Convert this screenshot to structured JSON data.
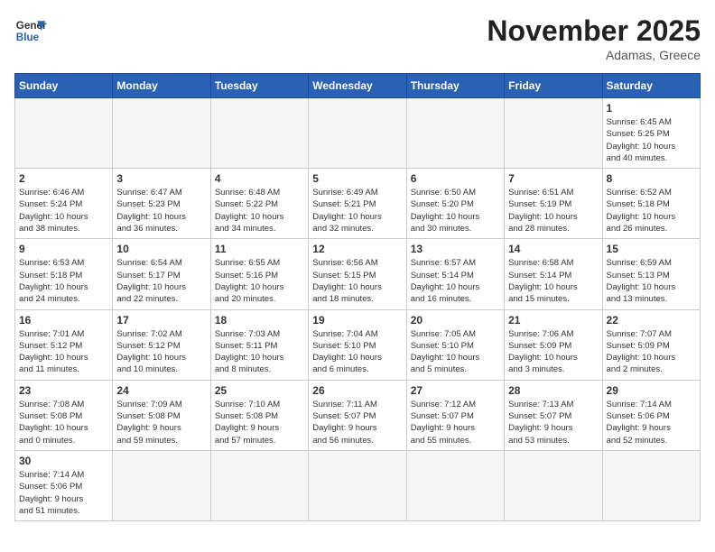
{
  "header": {
    "logo_text_general": "General",
    "logo_text_blue": "Blue",
    "month": "November 2025",
    "location": "Adamas, Greece"
  },
  "weekdays": [
    "Sunday",
    "Monday",
    "Tuesday",
    "Wednesday",
    "Thursday",
    "Friday",
    "Saturday"
  ],
  "weeks": [
    [
      {
        "day": "",
        "info": ""
      },
      {
        "day": "",
        "info": ""
      },
      {
        "day": "",
        "info": ""
      },
      {
        "day": "",
        "info": ""
      },
      {
        "day": "",
        "info": ""
      },
      {
        "day": "",
        "info": ""
      },
      {
        "day": "1",
        "info": "Sunrise: 6:45 AM\nSunset: 5:25 PM\nDaylight: 10 hours\nand 40 minutes."
      }
    ],
    [
      {
        "day": "2",
        "info": "Sunrise: 6:46 AM\nSunset: 5:24 PM\nDaylight: 10 hours\nand 38 minutes."
      },
      {
        "day": "3",
        "info": "Sunrise: 6:47 AM\nSunset: 5:23 PM\nDaylight: 10 hours\nand 36 minutes."
      },
      {
        "day": "4",
        "info": "Sunrise: 6:48 AM\nSunset: 5:22 PM\nDaylight: 10 hours\nand 34 minutes."
      },
      {
        "day": "5",
        "info": "Sunrise: 6:49 AM\nSunset: 5:21 PM\nDaylight: 10 hours\nand 32 minutes."
      },
      {
        "day": "6",
        "info": "Sunrise: 6:50 AM\nSunset: 5:20 PM\nDaylight: 10 hours\nand 30 minutes."
      },
      {
        "day": "7",
        "info": "Sunrise: 6:51 AM\nSunset: 5:19 PM\nDaylight: 10 hours\nand 28 minutes."
      },
      {
        "day": "8",
        "info": "Sunrise: 6:52 AM\nSunset: 5:18 PM\nDaylight: 10 hours\nand 26 minutes."
      }
    ],
    [
      {
        "day": "9",
        "info": "Sunrise: 6:53 AM\nSunset: 5:18 PM\nDaylight: 10 hours\nand 24 minutes."
      },
      {
        "day": "10",
        "info": "Sunrise: 6:54 AM\nSunset: 5:17 PM\nDaylight: 10 hours\nand 22 minutes."
      },
      {
        "day": "11",
        "info": "Sunrise: 6:55 AM\nSunset: 5:16 PM\nDaylight: 10 hours\nand 20 minutes."
      },
      {
        "day": "12",
        "info": "Sunrise: 6:56 AM\nSunset: 5:15 PM\nDaylight: 10 hours\nand 18 minutes."
      },
      {
        "day": "13",
        "info": "Sunrise: 6:57 AM\nSunset: 5:14 PM\nDaylight: 10 hours\nand 16 minutes."
      },
      {
        "day": "14",
        "info": "Sunrise: 6:58 AM\nSunset: 5:14 PM\nDaylight: 10 hours\nand 15 minutes."
      },
      {
        "day": "15",
        "info": "Sunrise: 6:59 AM\nSunset: 5:13 PM\nDaylight: 10 hours\nand 13 minutes."
      }
    ],
    [
      {
        "day": "16",
        "info": "Sunrise: 7:01 AM\nSunset: 5:12 PM\nDaylight: 10 hours\nand 11 minutes."
      },
      {
        "day": "17",
        "info": "Sunrise: 7:02 AM\nSunset: 5:12 PM\nDaylight: 10 hours\nand 10 minutes."
      },
      {
        "day": "18",
        "info": "Sunrise: 7:03 AM\nSunset: 5:11 PM\nDaylight: 10 hours\nand 8 minutes."
      },
      {
        "day": "19",
        "info": "Sunrise: 7:04 AM\nSunset: 5:10 PM\nDaylight: 10 hours\nand 6 minutes."
      },
      {
        "day": "20",
        "info": "Sunrise: 7:05 AM\nSunset: 5:10 PM\nDaylight: 10 hours\nand 5 minutes."
      },
      {
        "day": "21",
        "info": "Sunrise: 7:06 AM\nSunset: 5:09 PM\nDaylight: 10 hours\nand 3 minutes."
      },
      {
        "day": "22",
        "info": "Sunrise: 7:07 AM\nSunset: 5:09 PM\nDaylight: 10 hours\nand 2 minutes."
      }
    ],
    [
      {
        "day": "23",
        "info": "Sunrise: 7:08 AM\nSunset: 5:08 PM\nDaylight: 10 hours\nand 0 minutes."
      },
      {
        "day": "24",
        "info": "Sunrise: 7:09 AM\nSunset: 5:08 PM\nDaylight: 9 hours\nand 59 minutes."
      },
      {
        "day": "25",
        "info": "Sunrise: 7:10 AM\nSunset: 5:08 PM\nDaylight: 9 hours\nand 57 minutes."
      },
      {
        "day": "26",
        "info": "Sunrise: 7:11 AM\nSunset: 5:07 PM\nDaylight: 9 hours\nand 56 minutes."
      },
      {
        "day": "27",
        "info": "Sunrise: 7:12 AM\nSunset: 5:07 PM\nDaylight: 9 hours\nand 55 minutes."
      },
      {
        "day": "28",
        "info": "Sunrise: 7:13 AM\nSunset: 5:07 PM\nDaylight: 9 hours\nand 53 minutes."
      },
      {
        "day": "29",
        "info": "Sunrise: 7:14 AM\nSunset: 5:06 PM\nDaylight: 9 hours\nand 52 minutes."
      }
    ],
    [
      {
        "day": "30",
        "info": "Sunrise: 7:14 AM\nSunset: 5:06 PM\nDaylight: 9 hours\nand 51 minutes."
      },
      {
        "day": "",
        "info": ""
      },
      {
        "day": "",
        "info": ""
      },
      {
        "day": "",
        "info": ""
      },
      {
        "day": "",
        "info": ""
      },
      {
        "day": "",
        "info": ""
      },
      {
        "day": "",
        "info": ""
      }
    ]
  ]
}
